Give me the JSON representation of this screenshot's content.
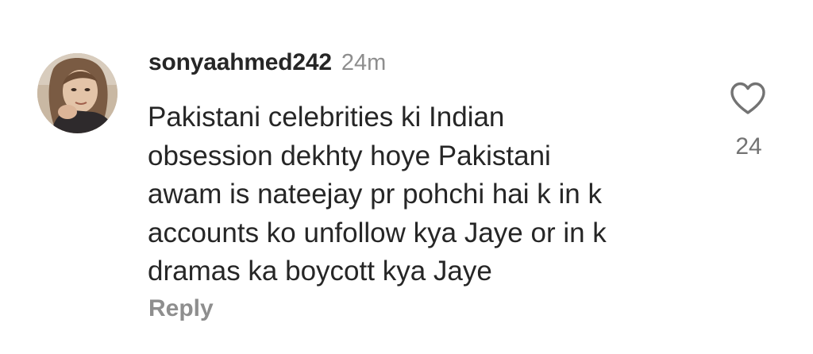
{
  "comment": {
    "username": "sonyaahmed242",
    "timestamp": "24m",
    "text": "Pakistani celebrities ki Indian\nobsession dekhty hoye Pakistani\nawam is nateejay pr pohchi hai k in  k\naccounts ko unfollow kya Jaye or in k\ndramas ka boycott kya Jaye",
    "reply_label": "Reply",
    "like_count": "24",
    "like_icon": "heart-outline-icon"
  },
  "colors": {
    "text_primary": "#262626",
    "text_secondary": "#8e8e8e",
    "background": "#ffffff"
  }
}
